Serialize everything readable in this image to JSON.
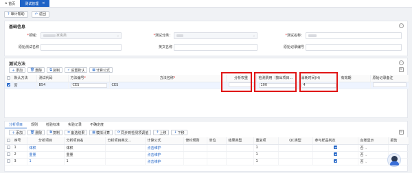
{
  "tabs": [
    {
      "label": "首页",
      "icon": "home-icon"
    },
    {
      "label": "测试管理",
      "icon": "",
      "active": true
    }
  ],
  "toolbar": {
    "help": "审计帮助",
    "back": "返回"
  },
  "basic": {
    "title": "基础信息",
    "fields": {
      "field": {
        "label": "领域",
        "value": "家禽类"
      },
      "test_class": {
        "label": "测试分类",
        "value": ""
      },
      "test_name": {
        "label": "测试名称",
        "value": ""
      },
      "origin_name": {
        "label": "原始测试名称",
        "value": ""
      },
      "alias": {
        "label": "英文名称",
        "value": ""
      },
      "record_no": {
        "label": "原始记录编号",
        "value": ""
      }
    }
  },
  "method": {
    "title": "测试方法",
    "buttons": [
      "添加",
      "删除",
      "复制",
      "设置默认",
      "计算公式"
    ],
    "columns": [
      "默认方法",
      "测试代码",
      "方法编号",
      "方法名称",
      "分析权重",
      "检测费用（按出项目...",
      "消耗时间(H)",
      "有效期",
      "原始记录备注"
    ],
    "row": {
      "default": "否",
      "code": "B54",
      "method_no": "CES",
      "method_name": "CES",
      "weight": "",
      "fee": "100",
      "time": "4",
      "validity": "",
      "note": ""
    }
  },
  "subtabs": [
    "分析项目",
    "规则",
    "检验标准",
    "实验记录",
    "不确定度"
  ],
  "analysis": {
    "buttons": [
      "添加",
      "删除",
      "复制",
      "备选结果",
      "模拟计算",
      "同步到检测项调值",
      "上移",
      "下移"
    ],
    "columns": [
      "序号",
      "分析项目",
      "分析项目名",
      "分析项目英文...",
      "计算公式",
      "修约规则",
      "单位",
      "结果类型",
      "重复项",
      "QC类型",
      "参与样品判定",
      "台账显示",
      "报告"
    ],
    "rows": [
      {
        "no": "1",
        "item": "体积",
        "name": "体积",
        "en": "",
        "formula": "点击维护",
        "rounding": "",
        "unit": "",
        "result_type": "",
        "repeat": "1",
        "qc": "",
        "judge": true,
        "ledger": "否"
      },
      {
        "no": "2",
        "item": "重量",
        "name": "重量",
        "en": "",
        "formula": "点击维护",
        "rounding": "",
        "unit": "",
        "result_type": "",
        "repeat": "1",
        "qc": "",
        "judge": true,
        "ledger": "否"
      },
      {
        "no": "3",
        "item": "1",
        "name": "1",
        "en": "",
        "formula": "点击维护",
        "rounding": "",
        "unit": "",
        "result_type": "",
        "repeat": "1",
        "qc": "",
        "judge": true,
        "ledger": "否"
      }
    ]
  }
}
